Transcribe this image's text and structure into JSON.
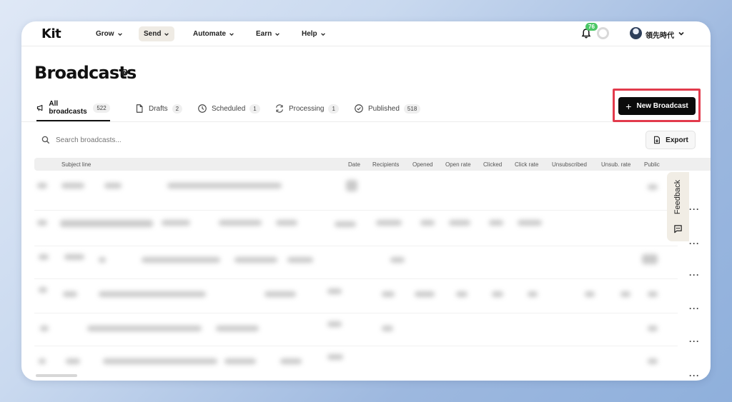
{
  "logo": "Kit",
  "nav": {
    "items": [
      {
        "label": "Grow"
      },
      {
        "label": "Send"
      },
      {
        "label": "Automate"
      },
      {
        "label": "Earn"
      },
      {
        "label": "Help"
      }
    ],
    "notifications_count": "76",
    "user_name": "領先時代"
  },
  "page": {
    "title": "Broadcasts",
    "help_icon": "?"
  },
  "tabs": [
    {
      "label": "All broadcasts",
      "count": "522",
      "icon": "megaphone-icon"
    },
    {
      "label": "Drafts",
      "count": "2",
      "icon": "document-icon"
    },
    {
      "label": "Scheduled",
      "count": "1",
      "icon": "clock-icon"
    },
    {
      "label": "Processing",
      "count": "1",
      "icon": "refresh-icon"
    },
    {
      "label": "Published",
      "count": "518",
      "icon": "check-circle-icon"
    }
  ],
  "new_broadcast_label": "New Broadcast",
  "search": {
    "placeholder": "Search broadcasts..."
  },
  "export_label": "Export",
  "table": {
    "columns": [
      "Subject line",
      "Date",
      "Recipients",
      "Opened",
      "Open rate",
      "Clicked",
      "Click rate",
      "Unsubscribed",
      "Unsub. rate",
      "Public"
    ],
    "row_menu": "···"
  },
  "feedback_label": "Feedback",
  "colors": {
    "highlight": "#e23a4c",
    "primary_button": "#0b0b0b",
    "badge": "#4cc766"
  }
}
